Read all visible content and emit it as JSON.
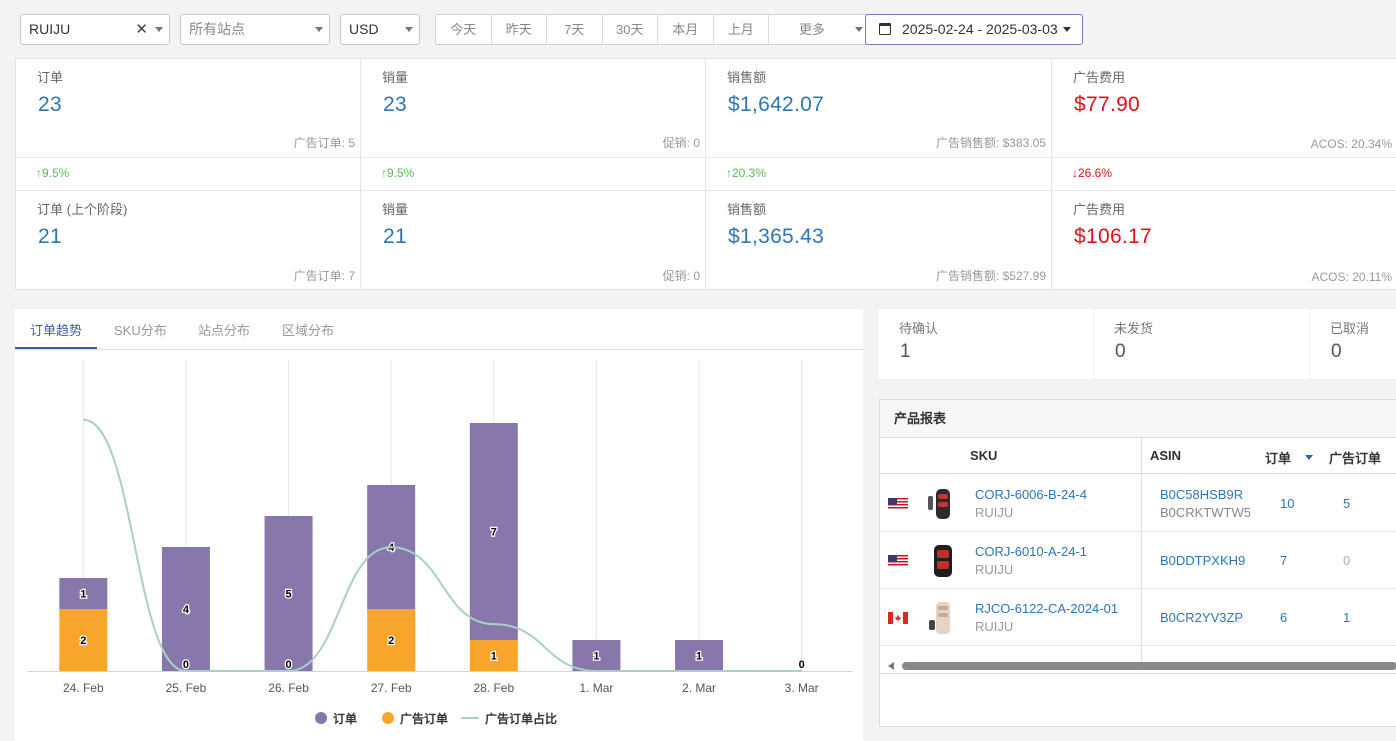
{
  "filters": {
    "store": "RUIJU",
    "store_clear": "✕",
    "site_placeholder": "所有站点",
    "currency": "USD",
    "ranges": [
      "今天",
      "昨天",
      "7天",
      "30天",
      "本月",
      "上月"
    ],
    "more": "更多",
    "date_range": "2025-02-24 - 2025-03-03"
  },
  "stats_current": [
    {
      "label": "订单",
      "value": "23",
      "sub": "广告订单: 5"
    },
    {
      "label": "销量",
      "value": "23",
      "sub": "促销: 0"
    },
    {
      "label": "销售额",
      "value": "$1,642.07",
      "sub": "广告销售额: $383.05"
    },
    {
      "label": "广告费用",
      "value": "$77.90",
      "sub": "ACOS: 20.34%"
    }
  ],
  "stats_change": [
    "↑9.5%",
    "↑9.5%",
    "↑20.3%",
    "↓26.6%"
  ],
  "stats_previous": [
    {
      "label": "订单 (上个阶段)",
      "value": "21",
      "sub": "广告订单: 7"
    },
    {
      "label": "销量",
      "value": "21",
      "sub": "促销: 0"
    },
    {
      "label": "销售额",
      "value": "$1,365.43",
      "sub": "广告销售额: $527.99"
    },
    {
      "label": "广告费用",
      "value": "$106.17",
      "sub": "ACOS: 20.11%"
    }
  ],
  "chart_tabs": [
    "订单趋势",
    "SKU分布",
    "站点分布",
    "区域分布"
  ],
  "chart_data": {
    "type": "bar",
    "stacked": true,
    "categories": [
      "24. Feb",
      "25. Feb",
      "26. Feb",
      "27. Feb",
      "28. Feb",
      "1. Mar",
      "2. Mar",
      "3. Mar"
    ],
    "series": [
      {
        "name": "订单",
        "values": [
          1,
          4,
          5,
          4,
          7,
          1,
          1,
          0
        ],
        "color": "#8877ab"
      },
      {
        "name": "广告订单",
        "values": [
          2,
          0,
          0,
          2,
          1,
          0,
          0,
          0
        ],
        "color": "#f8a52b"
      },
      {
        "name": "广告订单占比",
        "type": "line",
        "values": [
          0.67,
          0,
          0,
          0.33,
          0.125,
          0,
          0,
          0
        ],
        "color": "#aacfc6"
      }
    ],
    "grid": true,
    "legend": "bottom"
  },
  "status": [
    {
      "label": "待确认",
      "value": "1"
    },
    {
      "label": "未发货",
      "value": "0"
    },
    {
      "label": "已取消",
      "value": "0"
    }
  ],
  "report": {
    "title": "产品报表",
    "columns": [
      "SKU",
      "ASIN",
      "订单",
      "广告订单"
    ],
    "rows": [
      {
        "flag": "us-flag-icon",
        "sku": "CORJ-6006-B-24-4",
        "brand": "RUIJU",
        "asin": "B0C58HSB9R",
        "asin2": "B0CRKTWTW5",
        "orders": "10",
        "ad_orders": "5"
      },
      {
        "flag": "us-flag-icon",
        "sku": "CORJ-6010-A-24-1",
        "brand": "RUIJU",
        "asin": "B0DDTPXKH9",
        "asin2": "",
        "orders": "7",
        "ad_orders": "0"
      },
      {
        "flag": "ca-flag-icon",
        "sku": "RJCO-6122-CA-2024-01",
        "brand": "RUIJU",
        "asin": "B0CR2YV3ZP",
        "asin2": "",
        "orders": "6",
        "ad_orders": "1"
      }
    ]
  }
}
